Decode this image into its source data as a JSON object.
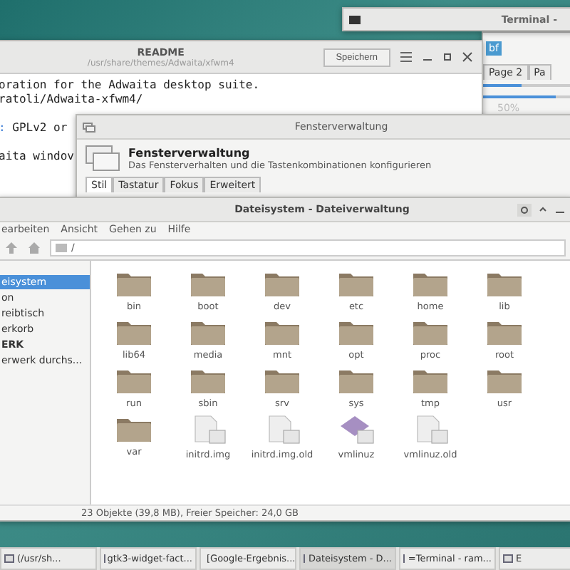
{
  "terminal_window": {
    "title": "Terminal -"
  },
  "widget_factory": {
    "button": "bf",
    "tabs": [
      {
        "label": "Page 2",
        "selected": false
      },
      {
        "label": "Pa",
        "selected": false
      }
    ],
    "progress": [
      {
        "level": 0.4
      },
      {
        "level": 0.75
      }
    ],
    "reading": "50%"
  },
  "readme_window": {
    "title": "README",
    "subtitle": "/usr/share/themes/Adwaita/xfwm4",
    "save_button": "Speichern",
    "lines": [
      {
        "text": "oration for the Adwaita desktop suite.",
        "kind": "plain"
      },
      {
        "text": "ratoli/Adwaita-xfwm4/",
        "kind": "plain"
      },
      {
        "kind": "blank"
      },
      {
        "text": "GPLv2 or",
        "kind": "marked",
        "prefix": ":"
      },
      {
        "kind": "blank"
      },
      {
        "text": "aita windov",
        "kind": "plain"
      }
    ]
  },
  "settings_dialog": {
    "title": "Fensterverwaltung",
    "heading": "Fensterverwaltung",
    "description": "Das Fensterverhalten und die Tastenkombinationen konfigurieren",
    "tabs": [
      {
        "label": "Stil",
        "selected": true
      },
      {
        "label": "Tastatur",
        "selected": false
      },
      {
        "label": "Fokus",
        "selected": false
      },
      {
        "label": "Erweitert",
        "selected": false
      }
    ]
  },
  "file_manager": {
    "title": "Dateisystem - Dateiverwaltung",
    "menu": [
      "earbeiten",
      "Ansicht",
      "Gehen zu",
      "Hilfe"
    ],
    "location": "/",
    "sidebar": [
      {
        "label": "eisystem",
        "kind": "item",
        "selected": true
      },
      {
        "label": "on",
        "kind": "item",
        "selected": false
      },
      {
        "label": "reibtisch",
        "kind": "item",
        "selected": false
      },
      {
        "label": "erkorb",
        "kind": "item",
        "selected": false
      },
      {
        "label": "ERK",
        "kind": "heading",
        "selected": false
      },
      {
        "label": "erwerk durchs...",
        "kind": "item",
        "selected": false
      }
    ],
    "items": [
      {
        "name": "bin",
        "kind": "folder"
      },
      {
        "name": "boot",
        "kind": "folder"
      },
      {
        "name": "dev",
        "kind": "folder"
      },
      {
        "name": "etc",
        "kind": "folder"
      },
      {
        "name": "home",
        "kind": "folder"
      },
      {
        "name": "lib",
        "kind": "folder"
      },
      {
        "name": "lib64",
        "kind": "folder"
      },
      {
        "name": "media",
        "kind": "folder"
      },
      {
        "name": "mnt",
        "kind": "folder"
      },
      {
        "name": "opt",
        "kind": "folder"
      },
      {
        "name": "proc",
        "kind": "folder"
      },
      {
        "name": "root",
        "kind": "folder"
      },
      {
        "name": "run",
        "kind": "folder"
      },
      {
        "name": "sbin",
        "kind": "folder"
      },
      {
        "name": "srv",
        "kind": "folder"
      },
      {
        "name": "sys",
        "kind": "folder"
      },
      {
        "name": "tmp",
        "kind": "folder"
      },
      {
        "name": "usr",
        "kind": "folder"
      },
      {
        "name": "var",
        "kind": "folder"
      },
      {
        "name": "initrd.img",
        "kind": "file"
      },
      {
        "name": "initrd.img.old",
        "kind": "file"
      },
      {
        "name": "vmlinuz",
        "kind": "kernel"
      },
      {
        "name": "vmlinuz.old",
        "kind": "file"
      }
    ],
    "status": "23 Objekte (39,8 MB), Freier Speicher: 24,0 GB"
  },
  "taskbar": [
    {
      "label": "(/usr/sh...",
      "selected": false
    },
    {
      "label": "gtk3-widget-fact...",
      "selected": false
    },
    {
      "label": "[Google-Ergebnis...",
      "selected": false
    },
    {
      "label": "Dateisystem - D...",
      "selected": true
    },
    {
      "label": "=Terminal - ram...",
      "selected": false
    },
    {
      "label": "E",
      "selected": false
    }
  ]
}
